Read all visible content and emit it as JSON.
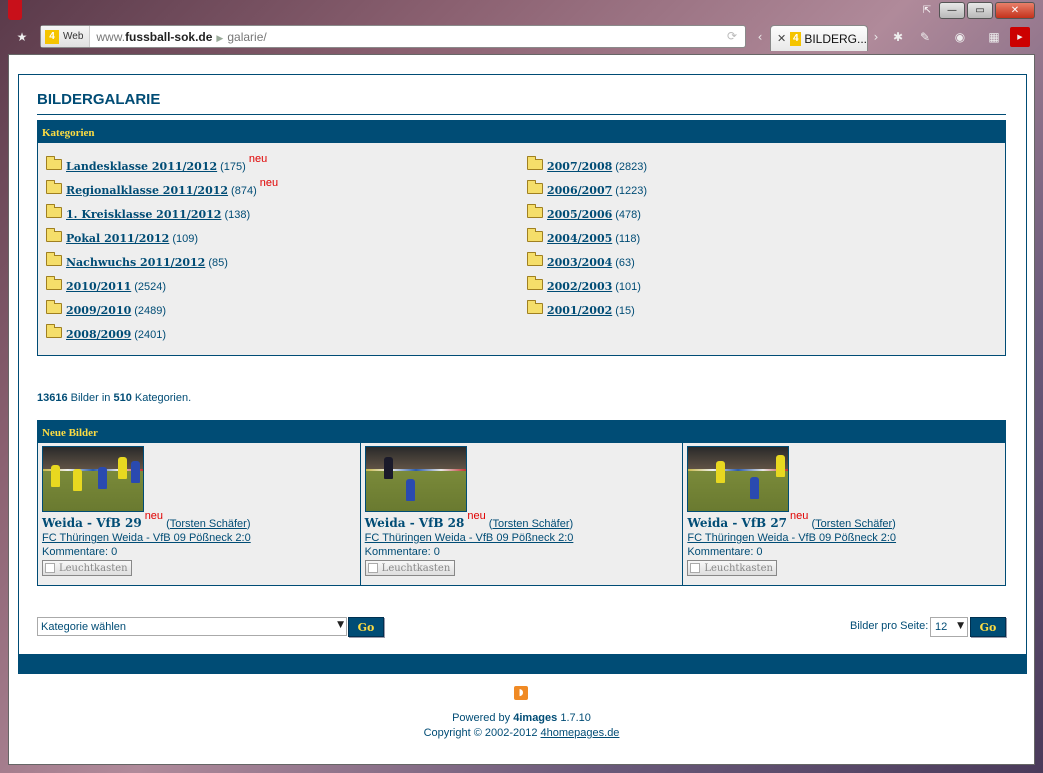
{
  "browser": {
    "address": {
      "badge": "Web",
      "domain_prefix": "www.",
      "domain": "fussball-sok.de",
      "path": "galarie/"
    },
    "tab": {
      "label": "BILDERG..."
    },
    "colors": {
      "accent": "#004c75",
      "highlight": "#fcdc43",
      "new_badge": "#e00000"
    }
  },
  "page": {
    "title": "BILDERGALARIE",
    "categories_header": "Kategorien",
    "categories_left": [
      {
        "name": "Landesklasse 2011/2012",
        "count": "(175)",
        "neu": "neu"
      },
      {
        "name": "Regionalklasse 2011/2012",
        "count": "(874)",
        "neu": "neu"
      },
      {
        "name": "1. Kreisklasse 2011/2012",
        "count": "(138)",
        "neu": ""
      },
      {
        "name": "Pokal 2011/2012",
        "count": "(109)",
        "neu": ""
      },
      {
        "name": "Nachwuchs 2011/2012",
        "count": "(85)",
        "neu": ""
      },
      {
        "name": "2010/2011",
        "count": "(2524)",
        "neu": ""
      },
      {
        "name": "2009/2010",
        "count": "(2489)",
        "neu": ""
      },
      {
        "name": "2008/2009",
        "count": "(2401)",
        "neu": ""
      }
    ],
    "categories_right": [
      {
        "name": "2007/2008",
        "count": "(2823)"
      },
      {
        "name": "2006/2007",
        "count": "(1223)"
      },
      {
        "name": "2005/2006",
        "count": "(478)"
      },
      {
        "name": "2004/2005",
        "count": "(118)"
      },
      {
        "name": "2003/2004",
        "count": "(63)"
      },
      {
        "name": "2002/2003",
        "count": "(101)"
      },
      {
        "name": "2001/2002",
        "count": "(15)"
      }
    ],
    "stats": {
      "images": "13616",
      "images_label": "Bilder in",
      "categories": "510",
      "categories_label": "Kategorien."
    },
    "new_images_header": "Neue Bilder",
    "new_images": [
      {
        "title": "Weida - VfB 29",
        "neu": "neu",
        "author": "Torsten Schäfer",
        "description": "FC Thüringen Weida - VfB 09 Pößneck 2:0",
        "comments": "Kommentare: 0",
        "lightbox": "Leuchtkasten"
      },
      {
        "title": "Weida - VfB 28",
        "neu": "neu",
        "author": "Torsten Schäfer",
        "description": "FC Thüringen Weida - VfB 09 Pößneck 2:0",
        "comments": "Kommentare: 0",
        "lightbox": "Leuchtkasten"
      },
      {
        "title": "Weida - VfB 27",
        "neu": "neu",
        "author": "Torsten Schäfer",
        "description": "FC Thüringen Weida - VfB 09 Pößneck 2:0",
        "comments": "Kommentare: 0",
        "lightbox": "Leuchtkasten"
      }
    ],
    "category_select": {
      "value": "Kategorie wählen"
    },
    "go_label": "Go",
    "per_page": {
      "label": "Bilder pro Seite:",
      "value": "12"
    },
    "footer": {
      "powered_prefix": "Powered by",
      "powered_brand": "4images",
      "powered_version": "1.7.10",
      "copyright": "Copyright © 2002-2012",
      "copyright_link": "4homepages.de"
    }
  }
}
